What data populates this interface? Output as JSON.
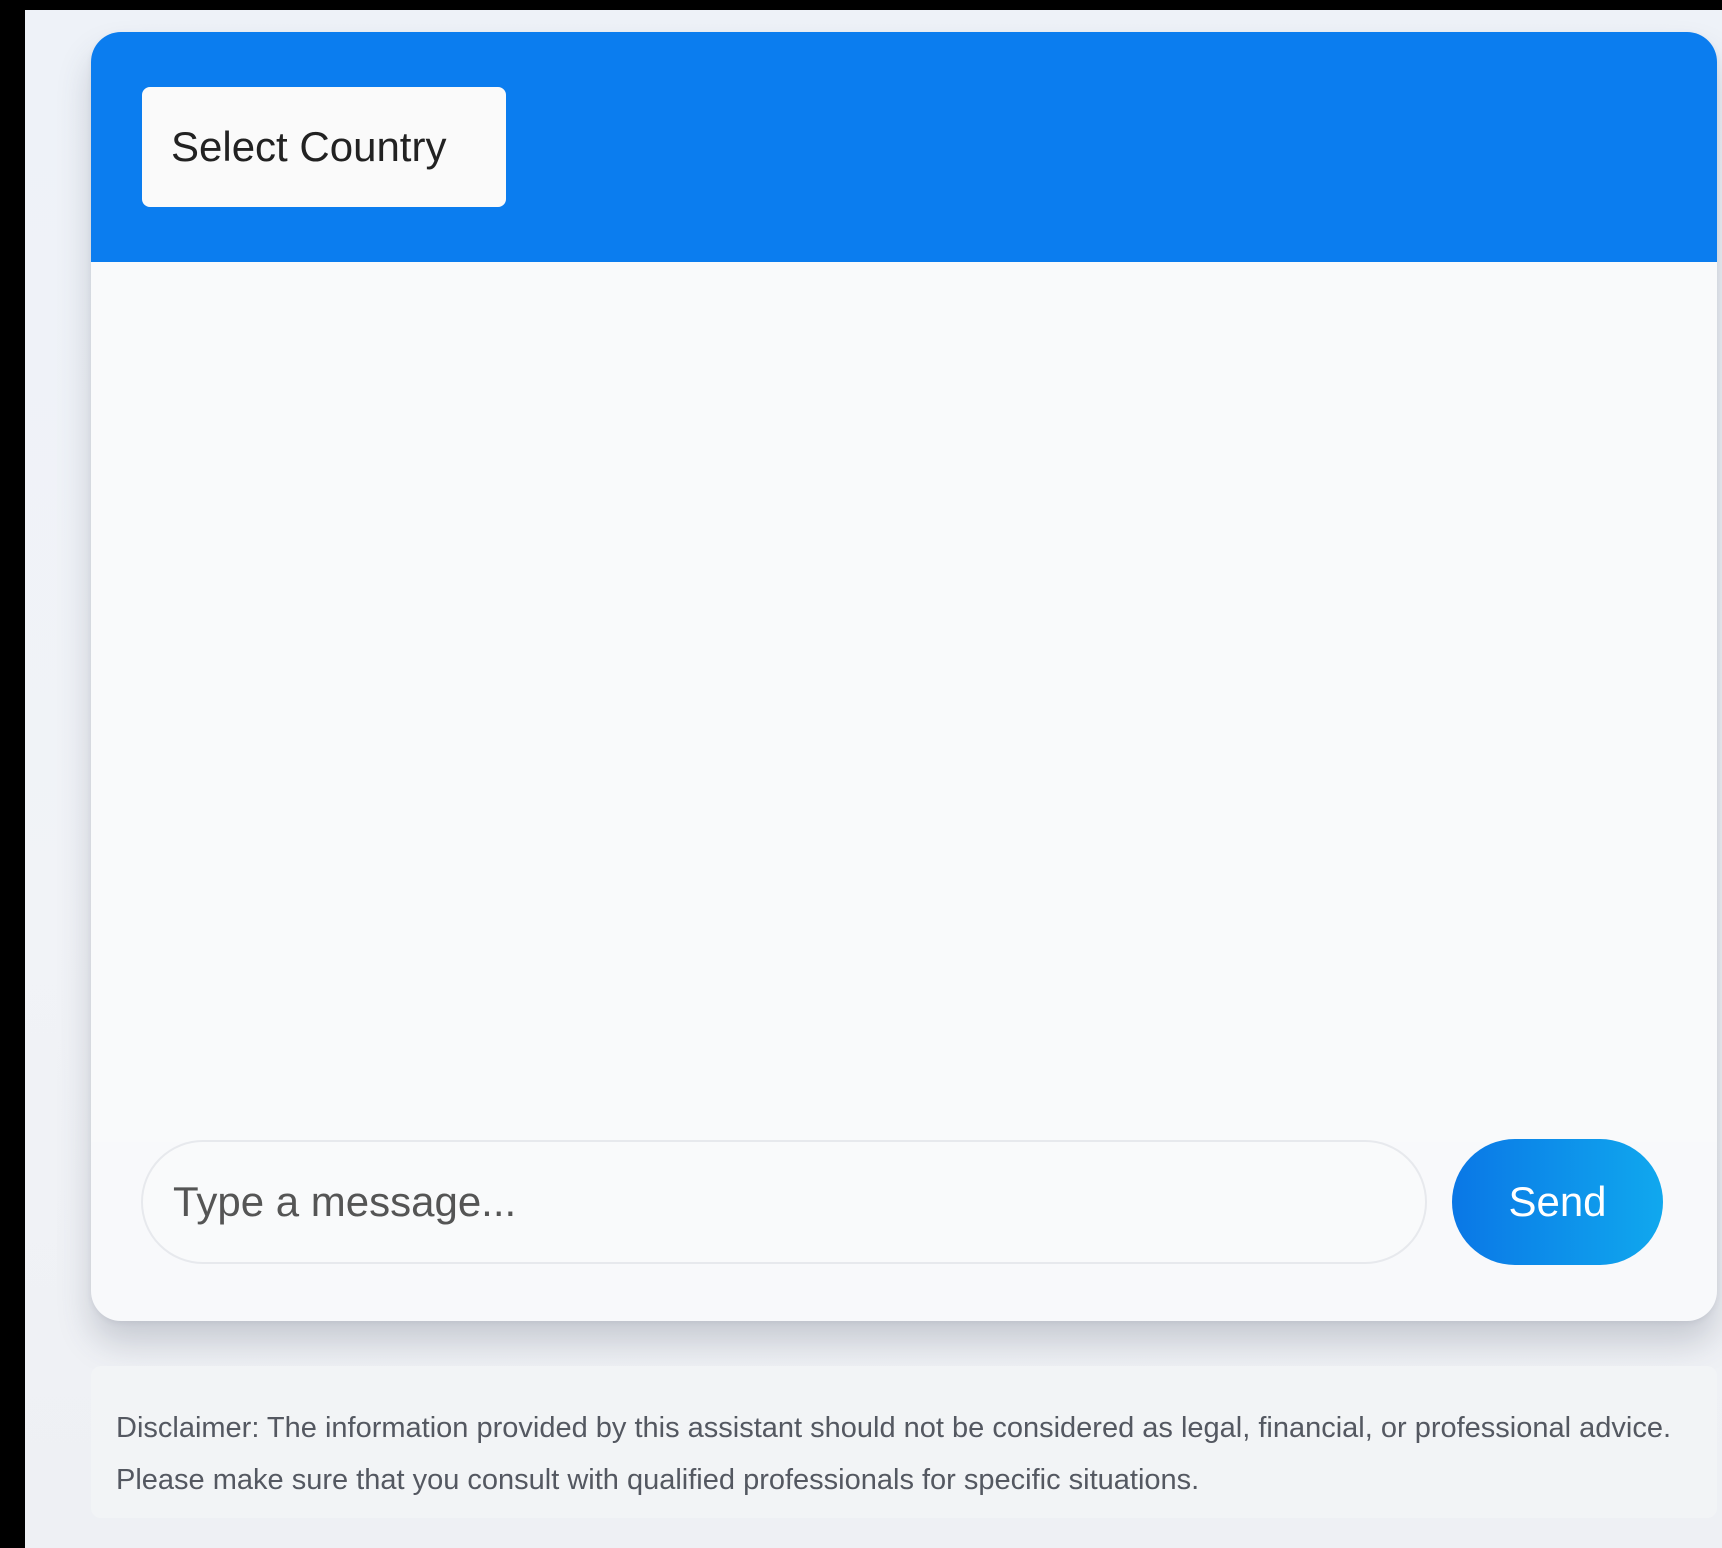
{
  "header": {
    "country_select_label": "Select Country"
  },
  "composer": {
    "placeholder": "Type a message...",
    "value": "",
    "send_label": "Send"
  },
  "disclaimer": {
    "text": "Disclaimer: The information provided by this assistant should not be considered as legal, financial, or professional advice. Please make sure that you consult with qualified professionals for specific situations."
  },
  "colors": {
    "header": "#0b7def",
    "send_button": "#0a77e6",
    "page_background": "#eef2f8",
    "card_background": "#f8f9fb"
  }
}
